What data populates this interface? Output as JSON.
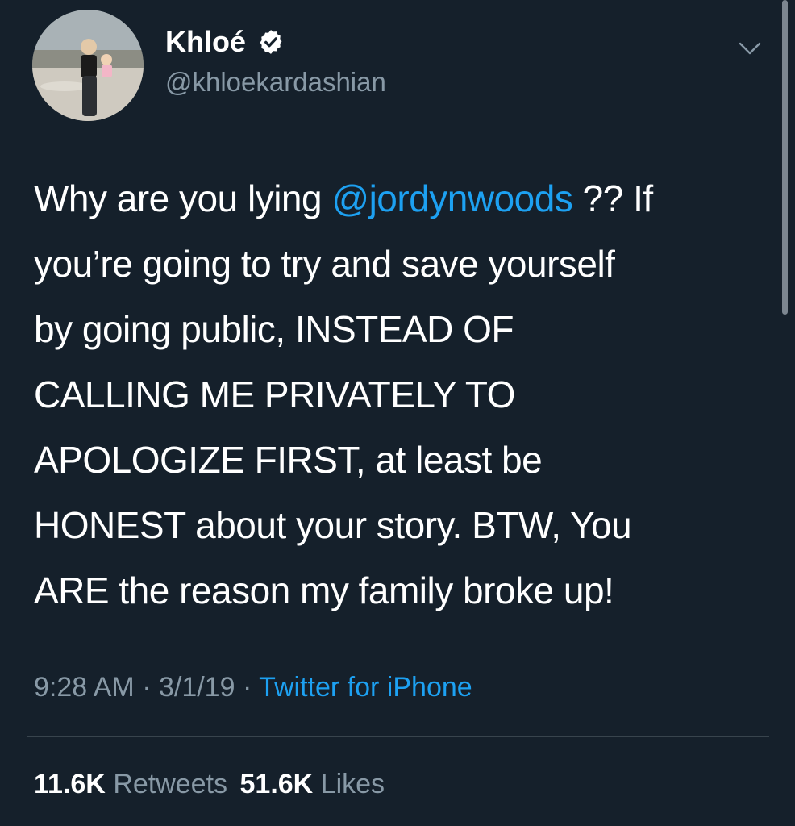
{
  "author": {
    "display_name": "Khloé",
    "handle": "@khloekardashian",
    "verified": true,
    "avatar_icon": "profile-photo"
  },
  "tweet": {
    "lines": [
      {
        "before": "Why are you lying ",
        "mention": "@jordynwoods",
        "after": " ?? If"
      },
      {
        "text": "you’re going to try and save yourself"
      },
      {
        "text": "by going public, INSTEAD OF"
      },
      {
        "text": "CALLING ME PRIVATELY TO"
      },
      {
        "text": "APOLOGIZE FIRST, at least be"
      },
      {
        "text": "HONEST about your story. BTW, You"
      },
      {
        "text": "ARE the reason my family broke up!"
      }
    ]
  },
  "meta": {
    "time": "9:28 AM",
    "separator": " · ",
    "date": "3/1/19",
    "source": "Twitter for iPhone"
  },
  "stats": {
    "retweets_count": "11.6K",
    "retweets_label": "Retweets",
    "likes_count": "51.6K",
    "likes_label": "Likes"
  },
  "colors": {
    "background": "#15202b",
    "accent": "#1da1f2",
    "secondary_text": "#8899a6",
    "divider": "#38444d"
  },
  "icons": {
    "verified": "verified-badge-icon",
    "menu": "chevron-down-icon"
  }
}
